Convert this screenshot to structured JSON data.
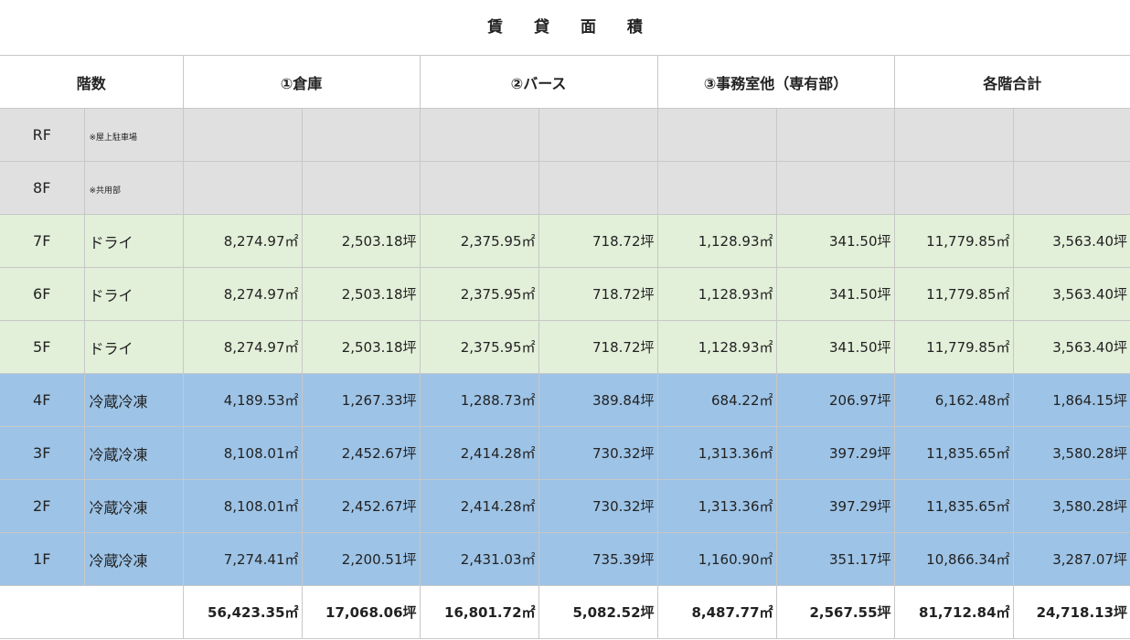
{
  "title": "賃 貸 面 積",
  "headers": {
    "floors": "階数",
    "warehouse": "①倉庫",
    "berth": "②バース",
    "office": "③事務室他（専有部）",
    "total": "各階合計"
  },
  "rows": [
    {
      "floor": "RF",
      "use": "",
      "note": "※屋上駐車場",
      "vals": [
        "",
        "",
        "",
        "",
        "",
        "",
        "",
        ""
      ],
      "style": "gray"
    },
    {
      "floor": "8F",
      "use": "",
      "note": "※共用部",
      "vals": [
        "",
        "",
        "",
        "",
        "",
        "",
        "",
        ""
      ],
      "style": "gray"
    },
    {
      "floor": "7F",
      "use": "ドライ",
      "note": "",
      "vals": [
        "8,274.97㎡",
        "2,503.18坪",
        "2,375.95㎡",
        "718.72坪",
        "1,128.93㎡",
        "341.50坪",
        "11,779.85㎡",
        "3,563.40坪"
      ],
      "style": "green"
    },
    {
      "floor": "6F",
      "use": "ドライ",
      "note": "",
      "vals": [
        "8,274.97㎡",
        "2,503.18坪",
        "2,375.95㎡",
        "718.72坪",
        "1,128.93㎡",
        "341.50坪",
        "11,779.85㎡",
        "3,563.40坪"
      ],
      "style": "green"
    },
    {
      "floor": "5F",
      "use": "ドライ",
      "note": "",
      "vals": [
        "8,274.97㎡",
        "2,503.18坪",
        "2,375.95㎡",
        "718.72坪",
        "1,128.93㎡",
        "341.50坪",
        "11,779.85㎡",
        "3,563.40坪"
      ],
      "style": "green"
    },
    {
      "floor": "4F",
      "use": "冷蔵冷凍",
      "note": "",
      "vals": [
        "4,189.53㎡",
        "1,267.33坪",
        "1,288.73㎡",
        "389.84坪",
        "684.22㎡",
        "206.97坪",
        "6,162.48㎡",
        "1,864.15坪"
      ],
      "style": "blue"
    },
    {
      "floor": "3F",
      "use": "冷蔵冷凍",
      "note": "",
      "vals": [
        "8,108.01㎡",
        "2,452.67坪",
        "2,414.28㎡",
        "730.32坪",
        "1,313.36㎡",
        "397.29坪",
        "11,835.65㎡",
        "3,580.28坪"
      ],
      "style": "blue"
    },
    {
      "floor": "2F",
      "use": "冷蔵冷凍",
      "note": "",
      "vals": [
        "8,108.01㎡",
        "2,452.67坪",
        "2,414.28㎡",
        "730.32坪",
        "1,313.36㎡",
        "397.29坪",
        "11,835.65㎡",
        "3,580.28坪"
      ],
      "style": "blue"
    },
    {
      "floor": "1F",
      "use": "冷蔵冷凍",
      "note": "",
      "vals": [
        "7,274.41㎡",
        "2,200.51坪",
        "2,431.03㎡",
        "735.39坪",
        "1,160.90㎡",
        "351.17坪",
        "10,866.34㎡",
        "3,287.07坪"
      ],
      "style": "blue"
    }
  ],
  "totals": [
    "56,423.35㎡",
    "17,068.06坪",
    "16,801.72㎡",
    "5,082.52坪",
    "8,487.77㎡",
    "2,567.55坪",
    "81,712.84㎡",
    "24,718.13坪"
  ]
}
